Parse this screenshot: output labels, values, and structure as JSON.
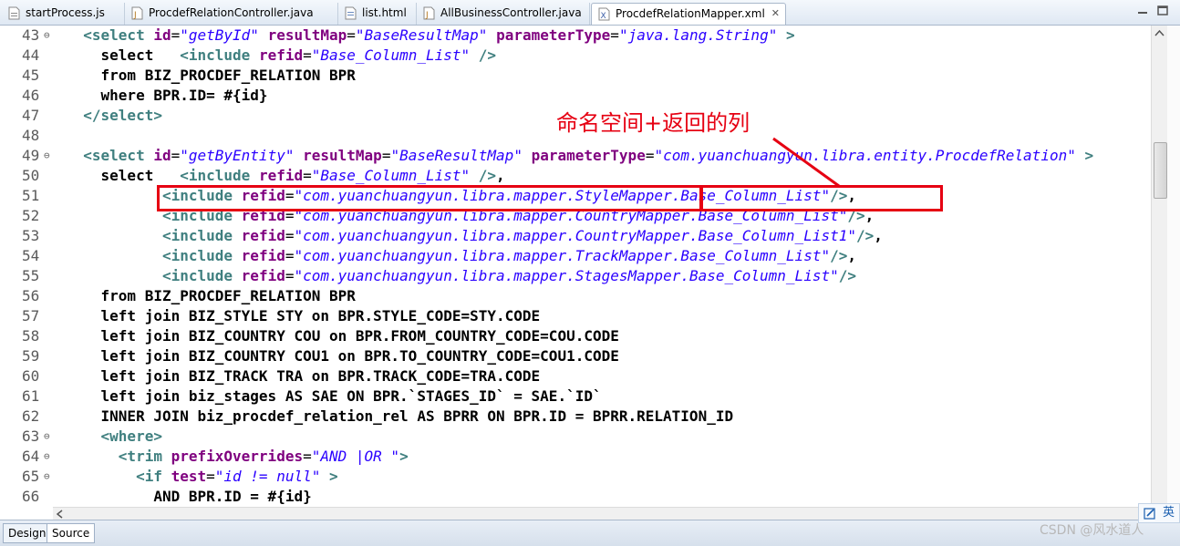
{
  "tabs": [
    {
      "label": "startProcess.js",
      "icon": "js-file-icon"
    },
    {
      "label": "ProcdefRelationController.java",
      "icon": "java-file-icon"
    },
    {
      "label": "list.html",
      "icon": "html-file-icon"
    },
    {
      "label": "AllBusinessController.java",
      "icon": "java-file-icon"
    },
    {
      "label": "ProcdefRelationMapper.xml",
      "icon": "xml-file-icon",
      "close": "✕"
    }
  ],
  "code_lines": [
    {
      "n": "43",
      "fold": "⊖",
      "segs": [
        [
          "p",
          "  "
        ],
        [
          "tag",
          "<select "
        ],
        [
          "attr",
          "id"
        ],
        [
          "eq",
          "="
        ],
        [
          "val",
          "\"getById\""
        ],
        [
          "p",
          " "
        ],
        [
          "attr",
          "resultMap"
        ],
        [
          "eq",
          "="
        ],
        [
          "val",
          "\"BaseResultMap\""
        ],
        [
          "p",
          " "
        ],
        [
          "attr",
          "parameterType"
        ],
        [
          "eq",
          "="
        ],
        [
          "val",
          "\"java.lang.String\""
        ],
        [
          "tag",
          " >"
        ]
      ]
    },
    {
      "n": "44",
      "fold": "",
      "segs": [
        [
          "p",
          "    "
        ],
        [
          "kw",
          "select"
        ],
        [
          "p",
          "   "
        ],
        [
          "tag",
          "<include "
        ],
        [
          "attr",
          "refid"
        ],
        [
          "eq",
          "="
        ],
        [
          "val",
          "\"Base_Column_List\""
        ],
        [
          "tag",
          " />"
        ]
      ]
    },
    {
      "n": "45",
      "fold": "",
      "segs": [
        [
          "p",
          "    "
        ],
        [
          "kw",
          "from BIZ_PROCDEF_RELATION BPR"
        ]
      ]
    },
    {
      "n": "46",
      "fold": "",
      "segs": [
        [
          "p",
          "    "
        ],
        [
          "kw",
          "where BPR.ID= #{id}"
        ]
      ]
    },
    {
      "n": "47",
      "fold": "",
      "segs": [
        [
          "p",
          "  "
        ],
        [
          "tag",
          "</select>"
        ]
      ]
    },
    {
      "n": "48",
      "fold": "",
      "segs": []
    },
    {
      "n": "49",
      "fold": "⊖",
      "segs": [
        [
          "p",
          "  "
        ],
        [
          "tag",
          "<select "
        ],
        [
          "attr",
          "id"
        ],
        [
          "eq",
          "="
        ],
        [
          "val",
          "\"getByEntity\""
        ],
        [
          "p",
          " "
        ],
        [
          "attr",
          "resultMap"
        ],
        [
          "eq",
          "="
        ],
        [
          "val",
          "\"BaseResultMap\""
        ],
        [
          "p",
          " "
        ],
        [
          "attr",
          "parameterType"
        ],
        [
          "eq",
          "="
        ],
        [
          "val",
          "\"com.yuanchuangyun.libra.entity.ProcdefRelation\""
        ],
        [
          "tag",
          " >"
        ]
      ]
    },
    {
      "n": "50",
      "fold": "",
      "segs": [
        [
          "p",
          "    "
        ],
        [
          "kw",
          "select"
        ],
        [
          "p",
          "   "
        ],
        [
          "tag",
          "<include "
        ],
        [
          "attr",
          "refid"
        ],
        [
          "eq",
          "="
        ],
        [
          "val",
          "\"Base_Column_List\""
        ],
        [
          "tag",
          " />"
        ],
        [
          "kw",
          ","
        ]
      ]
    },
    {
      "n": "51",
      "fold": "",
      "segs": [
        [
          "p",
          "           "
        ],
        [
          "tag",
          "<include "
        ],
        [
          "attr",
          "refid"
        ],
        [
          "eq",
          "="
        ],
        [
          "val",
          "\"com.yuanchuangyun.libra.mapper.StyleMapper.Base_Column_List\""
        ],
        [
          "tag",
          "/>"
        ],
        [
          "kw",
          ","
        ]
      ]
    },
    {
      "n": "52",
      "fold": "",
      "segs": [
        [
          "p",
          "           "
        ],
        [
          "tag",
          "<include "
        ],
        [
          "attr",
          "refid"
        ],
        [
          "eq",
          "="
        ],
        [
          "val",
          "\"com.yuanchuangyun.libra.mapper.CountryMapper.Base_Column_List\""
        ],
        [
          "tag",
          "/>"
        ],
        [
          "kw",
          ","
        ]
      ]
    },
    {
      "n": "53",
      "fold": "",
      "segs": [
        [
          "p",
          "           "
        ],
        [
          "tag",
          "<include "
        ],
        [
          "attr",
          "refid"
        ],
        [
          "eq",
          "="
        ],
        [
          "val",
          "\"com.yuanchuangyun.libra.mapper.CountryMapper.Base_Column_List1\""
        ],
        [
          "tag",
          "/>"
        ],
        [
          "kw",
          ","
        ]
      ]
    },
    {
      "n": "54",
      "fold": "",
      "segs": [
        [
          "p",
          "           "
        ],
        [
          "tag",
          "<include "
        ],
        [
          "attr",
          "refid"
        ],
        [
          "eq",
          "="
        ],
        [
          "val",
          "\"com.yuanchuangyun.libra.mapper.TrackMapper.Base_Column_List\""
        ],
        [
          "tag",
          "/>"
        ],
        [
          "kw",
          ","
        ]
      ]
    },
    {
      "n": "55",
      "fold": "",
      "segs": [
        [
          "p",
          "           "
        ],
        [
          "tag",
          "<include "
        ],
        [
          "attr",
          "refid"
        ],
        [
          "eq",
          "="
        ],
        [
          "val",
          "\"com.yuanchuangyun.libra.mapper.StagesMapper.Base_Column_List\""
        ],
        [
          "tag",
          "/>"
        ]
      ]
    },
    {
      "n": "56",
      "fold": "",
      "segs": [
        [
          "p",
          "    "
        ],
        [
          "kw",
          "from BIZ_PROCDEF_RELATION BPR"
        ]
      ]
    },
    {
      "n": "57",
      "fold": "",
      "segs": [
        [
          "p",
          "    "
        ],
        [
          "kw",
          "left join BIZ_STYLE STY on BPR.STYLE_CODE=STY.CODE"
        ]
      ]
    },
    {
      "n": "58",
      "fold": "",
      "segs": [
        [
          "p",
          "    "
        ],
        [
          "kw",
          "left join BIZ_COUNTRY COU on BPR.FROM_COUNTRY_CODE=COU.CODE"
        ]
      ]
    },
    {
      "n": "59",
      "fold": "",
      "segs": [
        [
          "p",
          "    "
        ],
        [
          "kw",
          "left join BIZ_COUNTRY COU1 on BPR.TO_COUNTRY_CODE=COU1.CODE"
        ]
      ]
    },
    {
      "n": "60",
      "fold": "",
      "segs": [
        [
          "p",
          "    "
        ],
        [
          "kw",
          "left join BIZ_TRACK TRA on BPR.TRACK_CODE=TRA.CODE"
        ]
      ]
    },
    {
      "n": "61",
      "fold": "",
      "segs": [
        [
          "p",
          "    "
        ],
        [
          "kw",
          "left join biz_stages AS SAE ON BPR.`STAGES_ID` = SAE.`ID`"
        ]
      ]
    },
    {
      "n": "62",
      "fold": "",
      "segs": [
        [
          "p",
          "    "
        ],
        [
          "kw",
          "INNER JOIN biz_procdef_relation_rel AS BPRR ON BPR.ID = BPRR.RELATION_ID"
        ]
      ]
    },
    {
      "n": "63",
      "fold": "⊖",
      "segs": [
        [
          "p",
          "    "
        ],
        [
          "tag",
          "<where>"
        ]
      ]
    },
    {
      "n": "64",
      "fold": "⊖",
      "segs": [
        [
          "p",
          "      "
        ],
        [
          "tag",
          "<trim "
        ],
        [
          "attr",
          "prefixOverrides"
        ],
        [
          "eq",
          "="
        ],
        [
          "val",
          "\"AND |OR \""
        ],
        [
          "tag",
          ">"
        ]
      ]
    },
    {
      "n": "65",
      "fold": "⊖",
      "segs": [
        [
          "p",
          "        "
        ],
        [
          "tag",
          "<if "
        ],
        [
          "attr",
          "test"
        ],
        [
          "eq",
          "="
        ],
        [
          "val",
          "\"id != null\""
        ],
        [
          "tag",
          " >"
        ]
      ]
    },
    {
      "n": "66",
      "fold": "",
      "segs": [
        [
          "p",
          "          "
        ],
        [
          "kw",
          "AND BPR.ID = #{id}"
        ]
      ]
    }
  ],
  "annotation": {
    "note": "命名空间+返回的列"
  },
  "bottom_tabs": [
    {
      "label": "Design"
    },
    {
      "label": "Source"
    }
  ],
  "watermark": "CSDN @风水道人",
  "ime": {
    "label": "英"
  },
  "colors": {
    "tag": "#3f7f7f",
    "attribute": "#7f007f",
    "value": "#2a00ff",
    "annotation": "#e60012"
  }
}
